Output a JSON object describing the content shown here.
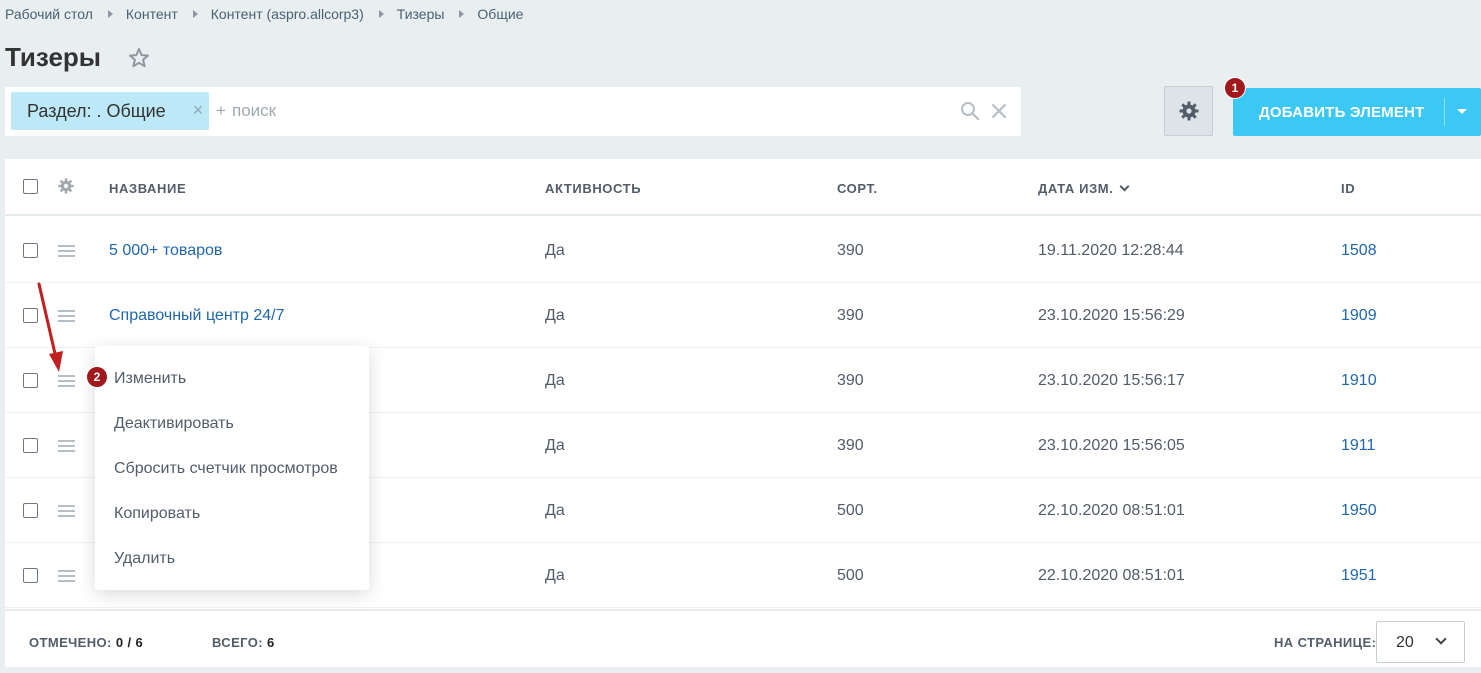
{
  "breadcrumb": [
    "Рабочий стол",
    "Контент",
    "Контент (aspro.allcorp3)",
    "Тизеры",
    "Общие"
  ],
  "page_title": "Тизеры",
  "filter": {
    "chip_label": "Раздел: . Общие",
    "chip_close": "×",
    "plus": "+",
    "placeholder": "поиск"
  },
  "toolbar": {
    "add_button_label": "ДОБАВИТЬ ЭЛЕМЕНТ",
    "badge_add": "1",
    "badge_menu": "2"
  },
  "colors": {
    "accent": "#3bc8f5",
    "link": "#2067b0",
    "badge": "#a3181d",
    "arrow": "#c0201f"
  },
  "table": {
    "columns": {
      "name": "НАЗВАНИЕ",
      "active": "АКТИВНОСТЬ",
      "sort": "СОРТ.",
      "date": "ДАТА ИЗМ.",
      "id": "ID"
    },
    "rows": [
      {
        "name": "5 000+ товаров",
        "active": "Да",
        "sort": "390",
        "date": "19.11.2020 12:28:44",
        "id": "1508"
      },
      {
        "name": "Справочный центр 24/7",
        "active": "Да",
        "sort": "390",
        "date": "23.10.2020 15:56:29",
        "id": "1909"
      },
      {
        "name": "",
        "active": "Да",
        "sort": "390",
        "date": "23.10.2020 15:56:17",
        "id": "1910"
      },
      {
        "name": "",
        "active": "Да",
        "sort": "390",
        "date": "23.10.2020 15:56:05",
        "id": "1911"
      },
      {
        "name": "",
        "active": "Да",
        "sort": "500",
        "date": "22.10.2020 08:51:01",
        "id": "1950"
      },
      {
        "name": "",
        "active": "Да",
        "sort": "500",
        "date": "22.10.2020 08:51:01",
        "id": "1951"
      }
    ]
  },
  "context_menu": [
    "Изменить",
    "Деактивировать",
    "Сбросить счетчик просмотров",
    "Копировать",
    "Удалить"
  ],
  "footer": {
    "selected_label": "ОТМЕЧЕНО:",
    "selected_value": "0 / 6",
    "total_label": "ВСЕГО:",
    "total_value": "6",
    "per_page_label": "НА СТРАНИЦЕ:",
    "per_page_value": "20"
  }
}
